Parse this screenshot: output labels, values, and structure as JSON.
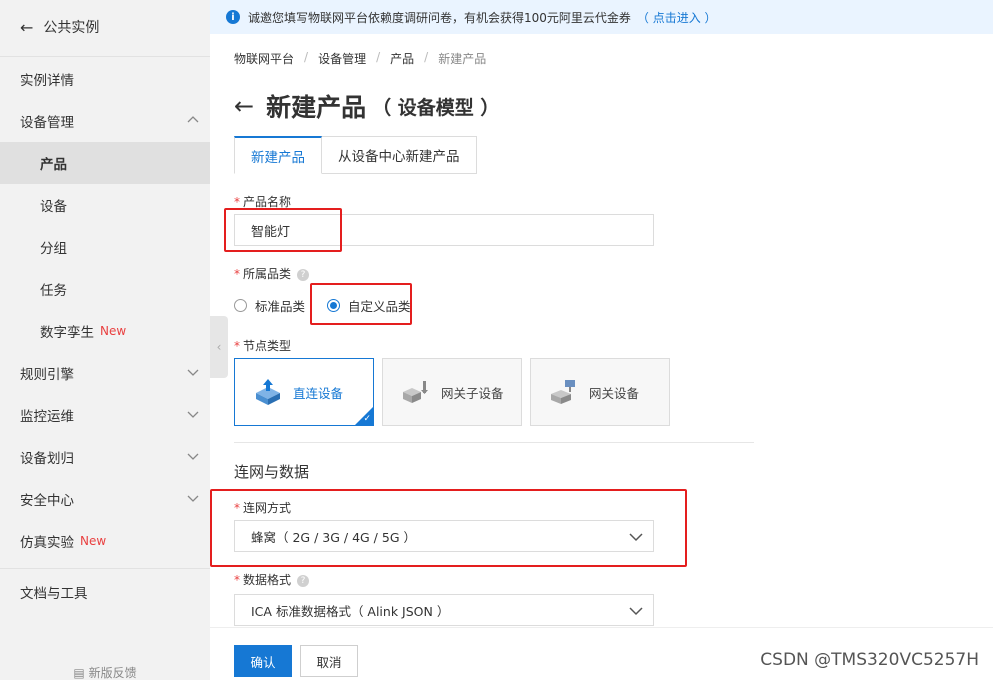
{
  "sidebar": {
    "back_label": "公共实例",
    "items": [
      {
        "label": "实例详情"
      },
      {
        "label": "设备管理"
      },
      {
        "label": "产品"
      },
      {
        "label": "设备"
      },
      {
        "label": "分组"
      },
      {
        "label": "任务"
      },
      {
        "label": "数字孪生",
        "badge": "New"
      },
      {
        "label": "规则引擎"
      },
      {
        "label": "监控运维"
      },
      {
        "label": "设备划归"
      },
      {
        "label": "安全中心"
      },
      {
        "label": "仿真实验",
        "badge": "New"
      },
      {
        "label": "文档与工具"
      }
    ],
    "feedback_label": "新版反馈"
  },
  "banner": {
    "text": "诚邀您填写物联网平台依赖度调研问卷，有机会获得100元阿里云代金券",
    "link": "（ 点击进入 ）"
  },
  "breadcrumb": [
    "物联网平台",
    "设备管理",
    "产品",
    "新建产品"
  ],
  "title": {
    "main": "新建产品",
    "sub": "（ 设备模型 ）"
  },
  "tabs": [
    {
      "label": "新建产品",
      "active": true
    },
    {
      "label": "从设备中心新建产品",
      "active": false
    }
  ],
  "form": {
    "product_name": {
      "label": "产品名称",
      "value": "智能灯"
    },
    "category": {
      "label": "所属品类",
      "options": [
        {
          "label": "标准品类",
          "selected": false
        },
        {
          "label": "自定义品类",
          "selected": true
        }
      ]
    },
    "node_type": {
      "label": "节点类型",
      "options": [
        {
          "label": "直连设备",
          "selected": true
        },
        {
          "label": "网关子设备",
          "selected": false
        },
        {
          "label": "网关设备",
          "selected": false
        }
      ]
    },
    "section_title": "连网与数据",
    "network": {
      "label": "连网方式",
      "value": "蜂窝（ 2G / 3G / 4G / 5G ）"
    },
    "data_format": {
      "label": "数据格式",
      "value": "ICA 标准数据格式（ Alink JSON ）"
    }
  },
  "buttons": {
    "confirm": "确认",
    "cancel": "取消"
  },
  "watermark": "CSDN @TMS320VC5257H",
  "colors": {
    "accent": "#1678d4",
    "highlight": "#e41e1e",
    "badge_new": "#e94040"
  }
}
